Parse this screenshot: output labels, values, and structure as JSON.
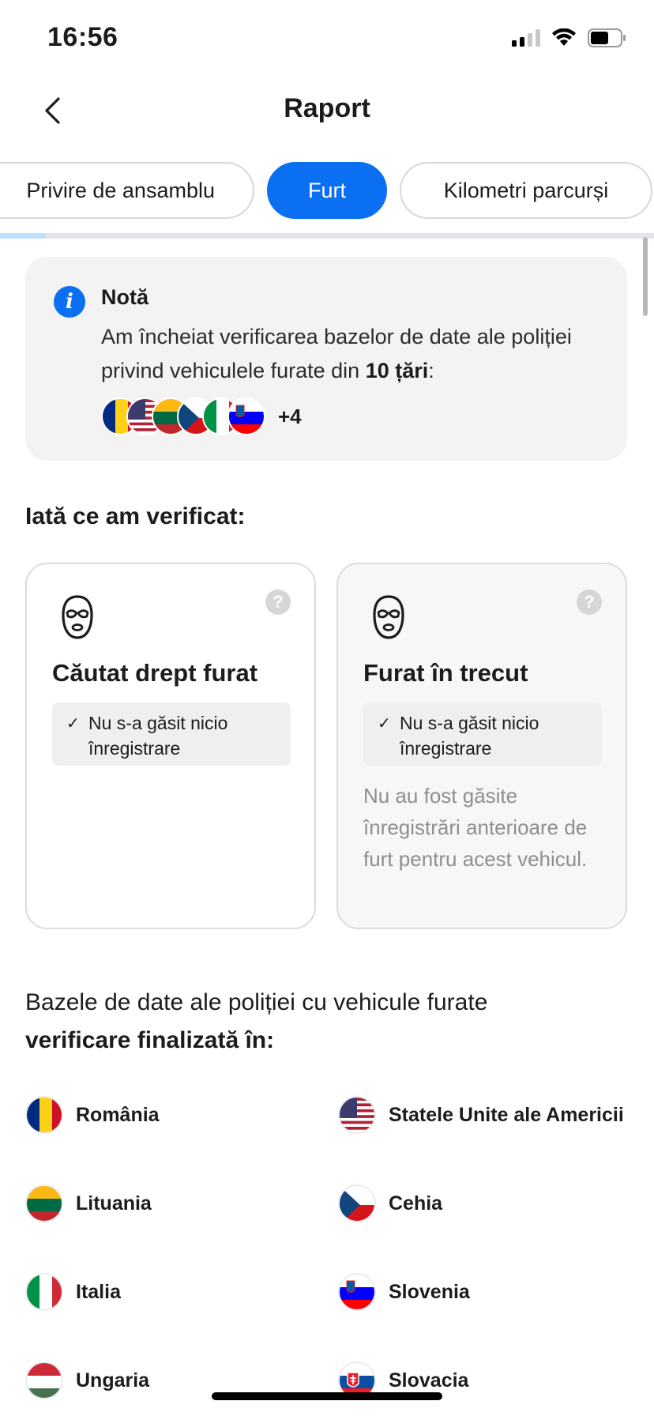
{
  "status_bar": {
    "time": "16:56"
  },
  "nav": {
    "title": "Raport"
  },
  "tabs": [
    {
      "label": "Privire de ansamblu",
      "active": false
    },
    {
      "label": "Furt",
      "active": true
    },
    {
      "label": "Kilometri parcurși",
      "active": false
    }
  ],
  "scroll_progress": 0.07,
  "colors": {
    "accent": "#0a6ff0",
    "card_bg": "#f3f3f4",
    "muted_text": "#8e8e93"
  },
  "note": {
    "icon": "info-icon",
    "title": "Notă",
    "text_part1": "Am încheiat verificarea bazelor de date ale poliției privind vehiculele furate din ",
    "text_bold": "10 țări",
    "text_part2": ":",
    "flags": [
      "romania",
      "usa",
      "lithuania",
      "czechia",
      "italy",
      "slovenia"
    ],
    "more_count": "+4"
  },
  "checked_section": {
    "title": "Iată ce am verificat:"
  },
  "checks": [
    {
      "icon": "balaclava-icon",
      "title": "Căutat drept furat",
      "result": "Nu s-a găsit nicio înregistrare",
      "description": ""
    },
    {
      "icon": "balaclava-icon",
      "title": "Furat în trecut",
      "result": "Nu s-a găsit nicio înregistrare",
      "description": "Nu au fost găsite înregistrări anterioare de furt pentru acest vehicul."
    }
  ],
  "databases": {
    "title_regular": "Bazele de date ale poliției cu vehicule furate",
    "title_bold": "verificare finalizată în:",
    "countries": [
      {
        "name": "România",
        "flag": "romania"
      },
      {
        "name": "Statele Unite ale Americii",
        "flag": "usa"
      },
      {
        "name": "Lituania",
        "flag": "lithuania"
      },
      {
        "name": "Cehia",
        "flag": "czechia"
      },
      {
        "name": "Italia",
        "flag": "italy"
      },
      {
        "name": "Slovenia",
        "flag": "slovenia"
      },
      {
        "name": "Ungaria",
        "flag": "hungary"
      },
      {
        "name": "Slovacia",
        "flag": "slovakia"
      }
    ]
  }
}
